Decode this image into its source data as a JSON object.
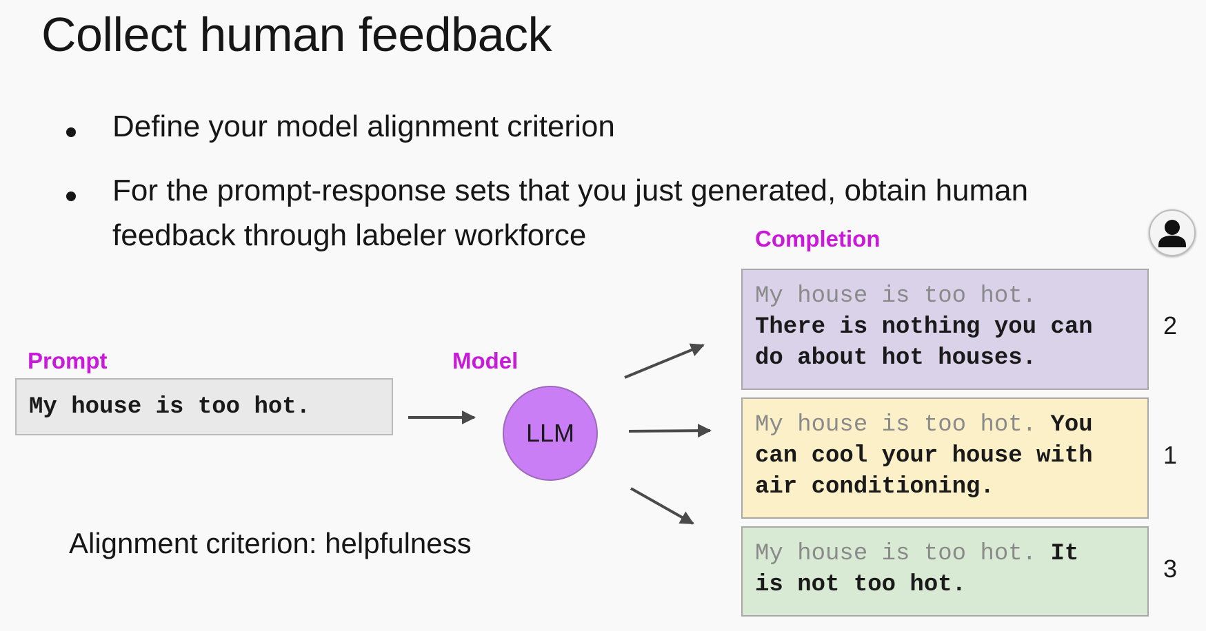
{
  "title": "Collect human feedback",
  "bullets": [
    {
      "lines": [
        "Define your model alignment criterion"
      ]
    },
    {
      "lines": [
        "For the prompt-response sets that you just generated, obtain human",
        "feedback through labeler workforce"
      ]
    }
  ],
  "diagram": {
    "prompt_label": "Prompt",
    "prompt_text": "My house is too hot.",
    "model_label": "Model",
    "model_name": "LLM",
    "completion_label": "Completion",
    "completions": [
      {
        "prefix": "My house is too hot.",
        "lines": [
          "My house is too hot.",
          "There is nothing you can",
          "do about hot houses."
        ],
        "rank": "2"
      },
      {
        "prefix": "My house is too hot.",
        "lines": [
          "My house is too hot. You",
          "can cool your house with",
          "air conditioning."
        ],
        "rank": "1"
      },
      {
        "prefix": "My house is too hot.",
        "lines": [
          "My house is too hot. It",
          "is not too hot."
        ],
        "rank": "3"
      }
    ],
    "criterion": "Alignment criterion: helpfulness",
    "labeler_icon": "person-icon"
  },
  "colors": {
    "accent_label": "#c81ad8",
    "llm_fill": "#c97ef5",
    "completion_fills": [
      "#d9d2e9",
      "#fcf0c9",
      "#d9ead4"
    ],
    "prompt_fill": "#e9e9e9"
  }
}
